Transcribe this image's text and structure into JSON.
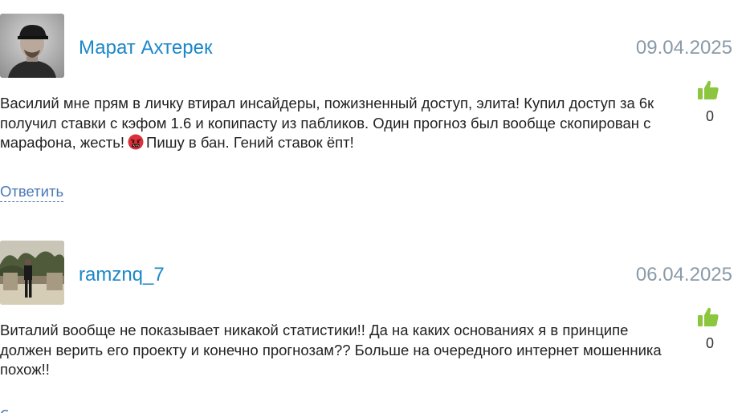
{
  "comments": [
    {
      "author": "Марат Ахтерек",
      "date": "09.04.2025",
      "likes": "0",
      "text_before": "Василий мне прям в личку втирал инсайдеры, пожизненный доступ, элита! Купил доступ за 6к получил ставки с кэфом 1.6 и копипасту из пабликов. Один прогноз был вообще скопирован с марафона, жесть!",
      "emoji": "angry-face-with-symbols-emoji",
      "text_after": "Пишу в бан. Гений ставок ёпт!",
      "reply_label": "Ответить"
    },
    {
      "author": "ramznq_7",
      "date": "06.04.2025",
      "likes": "0",
      "text": "Виталий вообще не показывает никакой статистики!! Да на каких основаниях я в принципе должен верить его проекту и конечно прогнозам?? Больше на очередного интернет мошенника похож!!",
      "reply_label": "Ответить"
    }
  ],
  "colors": {
    "author": "#1d87c9",
    "date": "#8a9aa8",
    "like_icon": "#8cc63f",
    "reply_link": "#4a79b6"
  },
  "icons": {
    "like": "thumbs-up-icon"
  }
}
